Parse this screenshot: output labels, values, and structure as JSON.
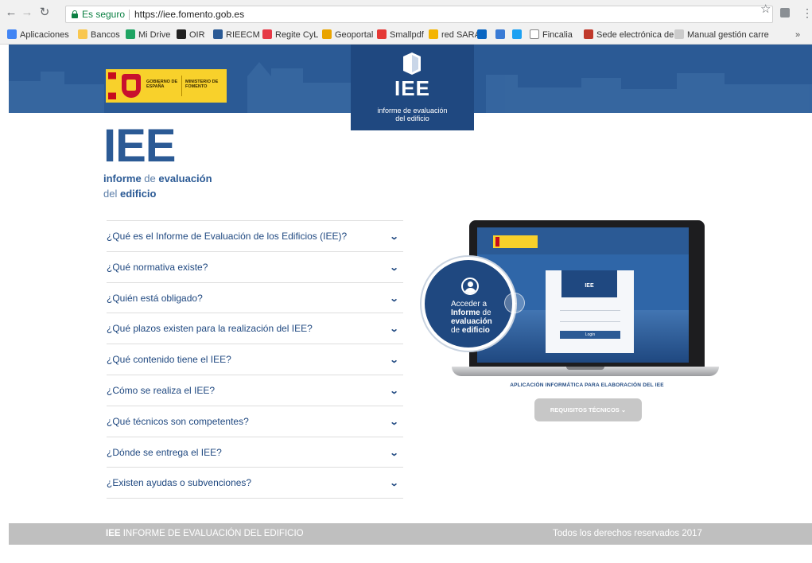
{
  "browser": {
    "secure_label": "Es seguro",
    "url": "https://iee.fomento.gob.es",
    "bookmarks": [
      {
        "label": "Aplicaciones",
        "icon": "apps-grid-icon",
        "color": "#4285f4"
      },
      {
        "label": "Bancos",
        "icon": "folder-icon",
        "color": "#f9c74f"
      },
      {
        "label": "Mi Drive",
        "icon": "drive-icon",
        "color": "#1fa463"
      },
      {
        "label": "OIR",
        "icon": "oir-icon",
        "color": "#222222"
      },
      {
        "label": "RIEECM",
        "icon": "house-icon",
        "color": "#2b5a95"
      },
      {
        "label": "Regite CyL",
        "icon": "regite-icon",
        "color": "#e63946"
      },
      {
        "label": "Geoportal",
        "icon": "geoportal-icon",
        "color": "#e9a400"
      },
      {
        "label": "Smallpdf",
        "icon": "smallpdf-icon",
        "color": "#e53935"
      },
      {
        "label": "red SARA",
        "icon": "sara-icon",
        "color": "#f4b400"
      },
      {
        "label": "",
        "icon": "linkedin-icon",
        "color": "#0a66c2"
      },
      {
        "label": "",
        "icon": "bookmark-icon",
        "color": "#3a7bd5"
      },
      {
        "label": "",
        "icon": "twitter-icon",
        "color": "#1da1f2"
      },
      {
        "label": "Fincalia",
        "icon": "page-icon",
        "color": "#ffffff"
      },
      {
        "label": "Sede electrónica de C",
        "icon": "sede-icon",
        "color": "#c0392b"
      },
      {
        "label": "Manual gestión carre",
        "icon": "loading-icon",
        "color": "#cccccc"
      }
    ],
    "more": "»"
  },
  "header": {
    "gob_line1": "GOBIERNO DE ESPAÑA",
    "gob_line2": "MINISTERIO DE FOMENTO",
    "badge_title": "IEE",
    "badge_sub1": "informe de evaluación",
    "badge_sub2": "del edificio"
  },
  "logo": {
    "title": "IEE",
    "line1_a": "informe",
    "line1_b": " de ",
    "line1_c": "evaluación",
    "line2_a": "del ",
    "line2_b": "edificio"
  },
  "faq": [
    "¿Qué es el Informe de Evaluación de los Edificios (IEE)?",
    "¿Qué normativa existe?",
    "¿Quién está obligado?",
    "¿Qué plazos existen para la realización del IEE?",
    "¿Qué contenido tiene el IEE?",
    "¿Cómo se realiza el IEE?",
    "¿Qué técnicos son competentes?",
    "¿Dónde se entrega el IEE?",
    "¿Existen ayudas o subvenciones?"
  ],
  "access": {
    "line1": "Acceder a",
    "line2_a": "Informe",
    "line2_b": " de",
    "line3": "evaluación",
    "line4_a": "de ",
    "line4_b": "edificio"
  },
  "laptop": {
    "login_title": "IEE",
    "login_button": "Login"
  },
  "app_caption": "APLICACIÓN INFORMÁTICA PARA ELABORACIÓN DEL IEE",
  "requirements_button": "REQUISITOS TÉCNICOS",
  "footer": {
    "left_bold": "IEE",
    "left_rest": " INFORME DE EVALUACIÓN DEL EDIFICIO",
    "right": "Todos los derechos reservados 2017"
  },
  "colors": {
    "primary": "#2b5a95",
    "dark": "#1f4880",
    "gob_yellow": "#f8d12b",
    "footer_grey": "#bfbfbf"
  }
}
